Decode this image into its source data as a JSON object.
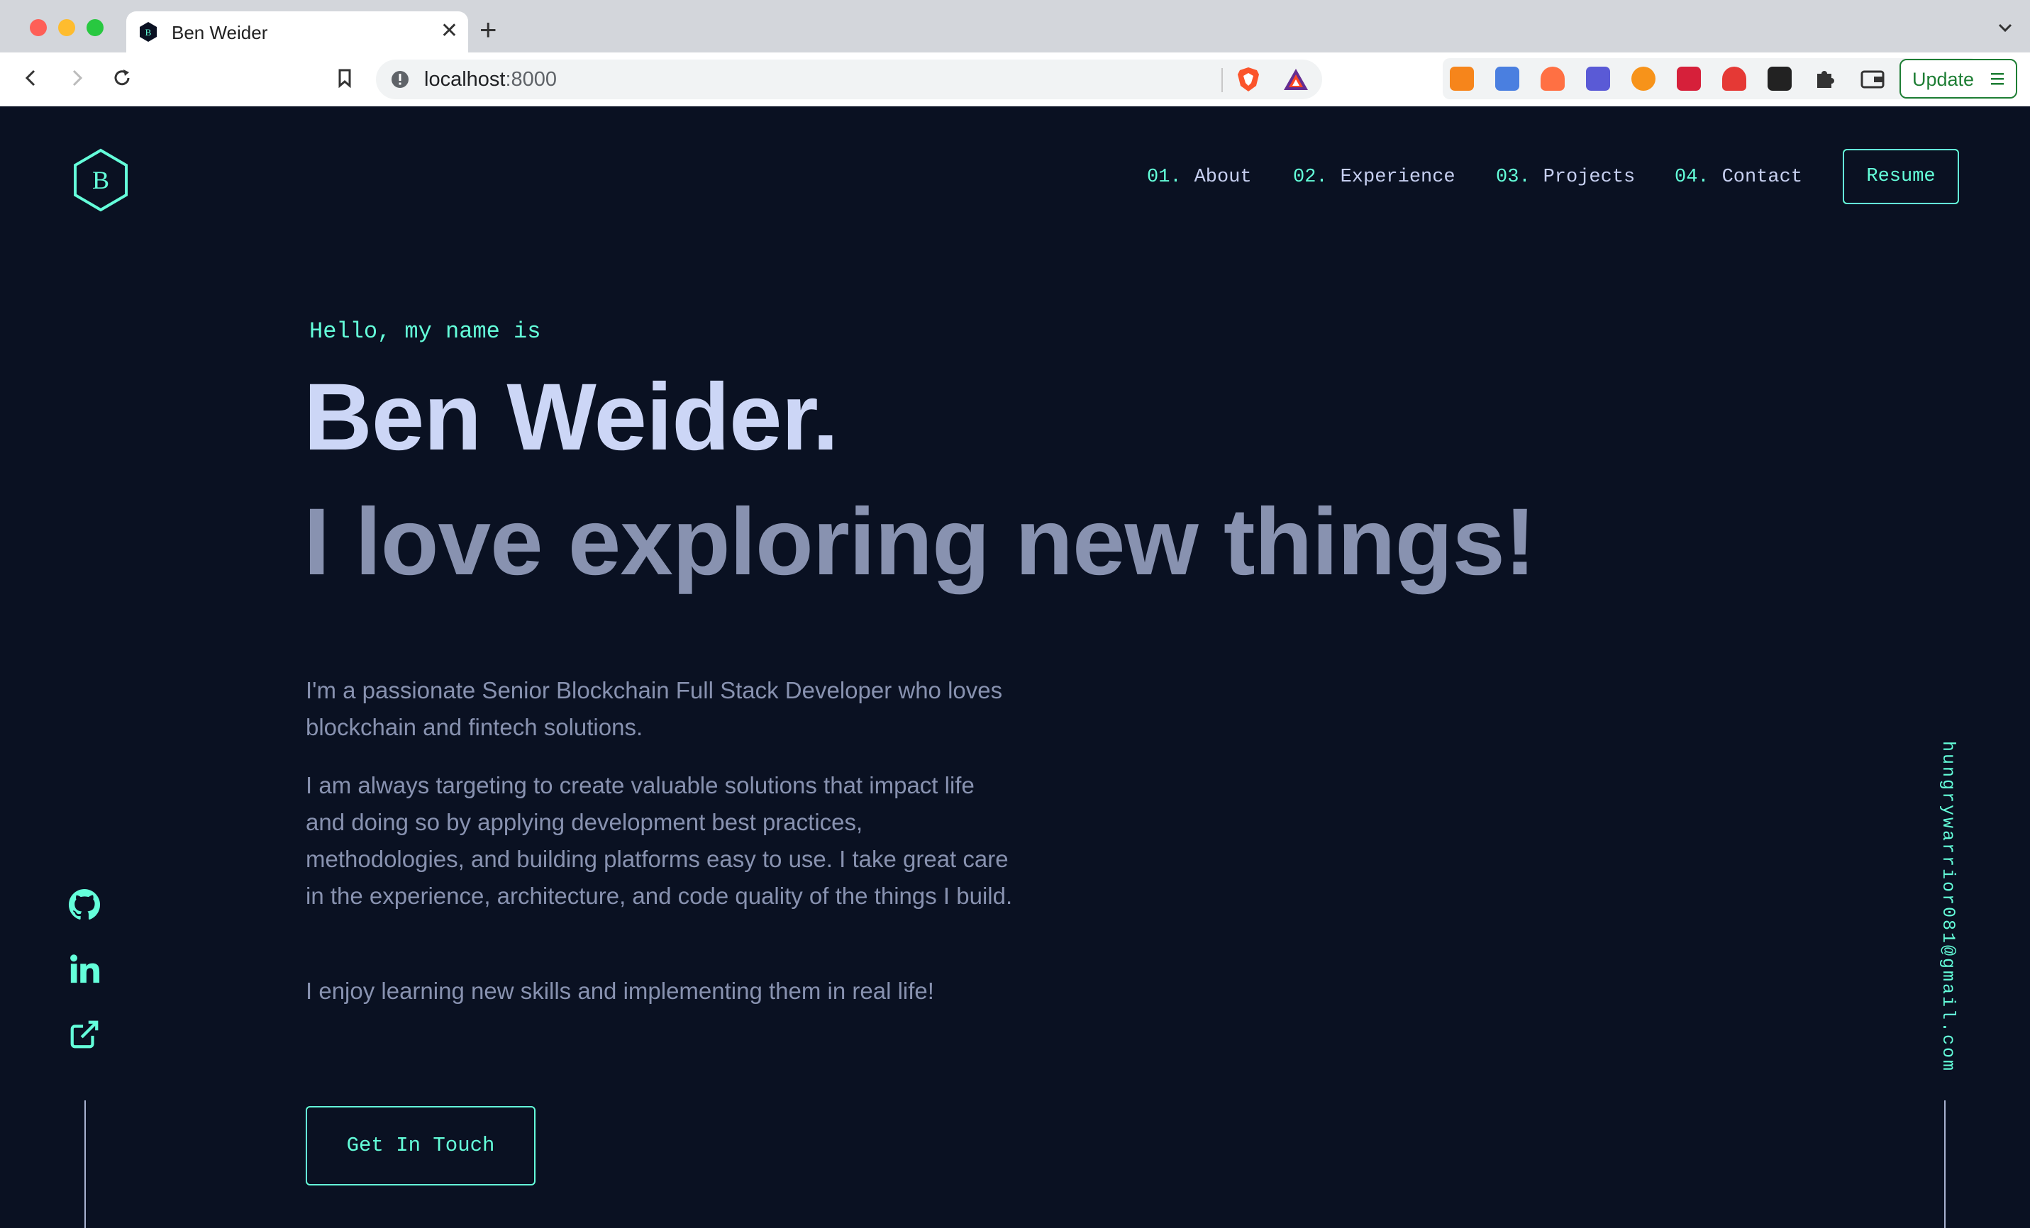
{
  "browser": {
    "tab": {
      "title": "Ben Weider",
      "favicon_letter": "B"
    },
    "address_bar": {
      "host": "localhost",
      "port": ":8000"
    },
    "update_label": "Update"
  },
  "site": {
    "logo_letter": "B",
    "nav": [
      {
        "num": "01.",
        "label": "About"
      },
      {
        "num": "02.",
        "label": "Experience"
      },
      {
        "num": "03.",
        "label": "Projects"
      },
      {
        "num": "04.",
        "label": "Contact"
      }
    ],
    "resume_label": "Resume",
    "hero": {
      "greeting": "Hello, my name is",
      "name": "Ben Weider.",
      "tagline": "I love exploring new things!",
      "bio": [
        "I'm a passionate Senior Blockchain Full Stack Developer who loves blockchain and fintech solutions.",
        "I am always targeting to create valuable solutions that impact life and doing so by applying development best practices, methodologies, and building platforms easy to use. I take great care in the experience, architecture, and code quality of the things I build.",
        "I enjoy learning new skills and implementing them in real life!"
      ],
      "cta_label": "Get In Touch"
    },
    "email": "hungrywarrior081@gmail.com",
    "social_icons": [
      "github-icon",
      "linkedin-icon",
      "external-link-icon"
    ]
  },
  "colors": {
    "background": "#0a1122",
    "accent": "#64ffda",
    "heading_light": "#ccd6f6",
    "heading_muted": "#8892b0"
  }
}
